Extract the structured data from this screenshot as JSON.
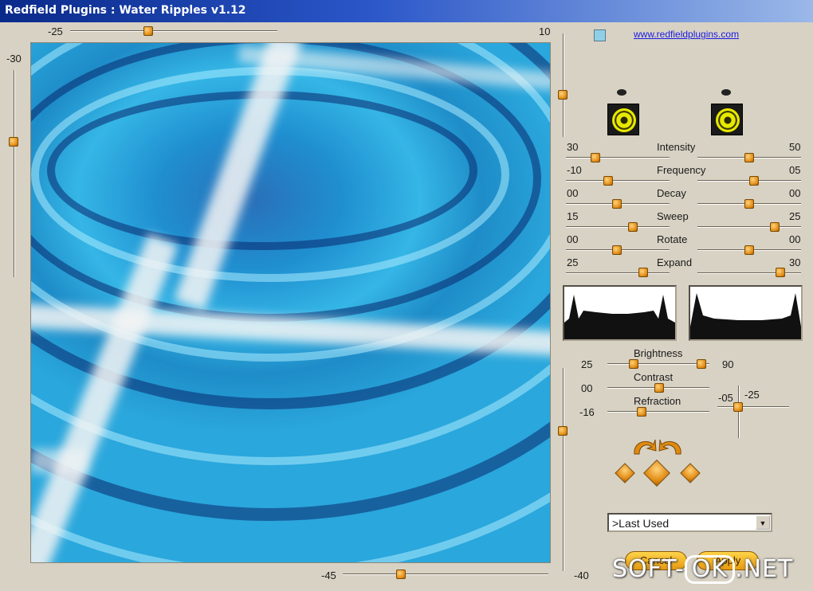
{
  "window": {
    "title": "Redfield Plugins : Water Ripples v1.12"
  },
  "preview_sliders": {
    "top_min": "-25",
    "top_max": "10",
    "top_value": 0.35,
    "left_label": "-30",
    "left_value": 0.15,
    "right_value": 0.12,
    "bottom_min": "-45",
    "bottom_max": "-40",
    "bottom_value": 0.3
  },
  "link": {
    "text": "www.redfieldplugins.com"
  },
  "parameters": [
    {
      "name": "Intensity",
      "left": "30",
      "right": "50",
      "left_pos": 0.25,
      "right_pos": 0.5
    },
    {
      "name": "Frequency",
      "left": "-10",
      "right": "05",
      "left_pos": 0.38,
      "right_pos": 0.55
    },
    {
      "name": "Decay",
      "left": "00",
      "right": "00",
      "left_pos": 0.5,
      "right_pos": 0.5
    },
    {
      "name": "Sweep",
      "left": "15",
      "right": "25",
      "left_pos": 0.65,
      "right_pos": 0.75
    },
    {
      "name": "Rotate",
      "left": "00",
      "right": "00",
      "left_pos": 0.5,
      "right_pos": 0.5
    },
    {
      "name": "Expand",
      "left": "25",
      "right": "30",
      "left_pos": 0.75,
      "right_pos": 0.8
    }
  ],
  "adjustments": [
    {
      "name": "Brightness",
      "value": "25",
      "pos": 0.25,
      "pos2": 0.9,
      "extra": "90"
    },
    {
      "name": "Contrast",
      "value": "00",
      "pos": 0.5
    },
    {
      "name": "Refraction",
      "value": "-16",
      "pos": 0.3
    }
  ],
  "position_xy": {
    "x_label": "-05",
    "y_label": "-25"
  },
  "preset": {
    "selected": ">Last Used"
  },
  "buttons": {
    "cancel": "Cancel",
    "ok": "Apply"
  },
  "watermark": {
    "left": "SOFT-",
    "ok": "OK",
    "right": ".NET"
  },
  "icons": {
    "eye_left": "eye-icon",
    "eye_right": "eye-icon",
    "speaker_left": "speaker-icon",
    "speaker_right": "speaker-icon",
    "rotate_left": "rotate-left-icon",
    "rotate_right": "rotate-right-icon",
    "nav": "diamond-arrow-icon"
  },
  "colors": {
    "accent": "#e08a12",
    "title_start": "#0a2a8a",
    "link": "#1a1ae0"
  }
}
